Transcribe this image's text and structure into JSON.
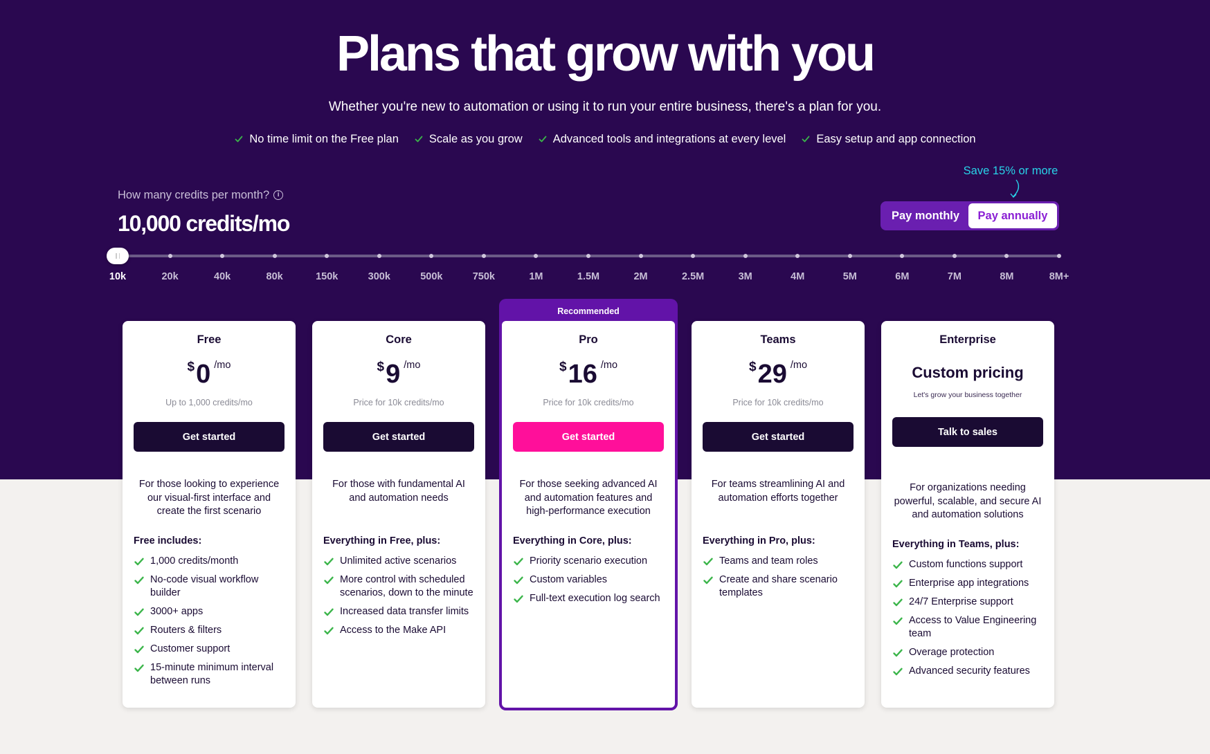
{
  "hero": {
    "title": "Plans that grow with you",
    "subtitle": "Whether you're new to automation or using it to run your entire business, there's a plan for you.",
    "benefits": [
      "No time limit on the Free plan",
      "Scale as you grow",
      "Advanced tools and integrations at every level",
      "Easy setup and app connection"
    ]
  },
  "credits": {
    "question": "How many credits per month?",
    "value": "10,000 credits/mo",
    "slider_ticks": [
      "10k",
      "20k",
      "40k",
      "80k",
      "150k",
      "300k",
      "500k",
      "750k",
      "1M",
      "1.5M",
      "2M",
      "2.5M",
      "3M",
      "4M",
      "5M",
      "6M",
      "7M",
      "8M",
      "8M+"
    ],
    "selected_tick": "10k"
  },
  "billing": {
    "save_note": "Save 15% or more",
    "monthly_label": "Pay monthly",
    "annually_label": "Pay annually",
    "selected": "Pay annually"
  },
  "recommended_label": "Recommended",
  "plans": [
    {
      "name": "Free",
      "currency": "$",
      "amount": "0",
      "per": "/mo",
      "price_note": "Up to 1,000 credits/mo",
      "cta": "Get started",
      "description": "For those looking to experience our visual-first interface and create the first scenario",
      "includes_title": "Free includes:",
      "features": [
        "1,000 credits/month",
        "No-code visual workflow builder",
        "3000+ apps",
        "Routers & filters",
        "Customer support",
        "15-minute minimum interval between runs"
      ]
    },
    {
      "name": "Core",
      "currency": "$",
      "amount": "9",
      "per": "/mo",
      "price_note": "Price for 10k credits/mo",
      "cta": "Get started",
      "description": "For those with fundamental AI and automation needs",
      "includes_title": "Everything in Free, plus:",
      "features": [
        "Unlimited active scenarios",
        "More control with scheduled scenarios, down to the minute",
        "Increased data transfer limits",
        "Access to the Make API"
      ]
    },
    {
      "name": "Pro",
      "currency": "$",
      "amount": "16",
      "per": "/mo",
      "price_note": "Price for 10k credits/mo",
      "cta": "Get started",
      "description": "For those seeking advanced AI and automation features and high-performance execution",
      "includes_title": "Everything in Core, plus:",
      "features": [
        "Priority scenario execution",
        "Custom variables",
        "Full-text execution log search"
      ]
    },
    {
      "name": "Teams",
      "currency": "$",
      "amount": "29",
      "per": "/mo",
      "price_note": "Price for 10k credits/mo",
      "cta": "Get started",
      "description": "For teams streamlining AI and automation efforts together",
      "includes_title": "Everything in Pro, plus:",
      "features": [
        "Teams and team roles",
        "Create and share scenario templates"
      ]
    },
    {
      "name": "Enterprise",
      "custom_price": "Custom pricing",
      "price_note": "Let's grow your business together",
      "cta": "Talk to sales",
      "description": "For organizations needing powerful, scalable, and secure AI and automation solutions",
      "includes_title": "Everything in Teams, plus:",
      "features": [
        "Custom functions support",
        "Enterprise app integrations",
        "24/7 Enterprise support",
        "Access to Value Engineering team",
        "Overage protection",
        "Advanced security features"
      ]
    }
  ],
  "colors": {
    "hero_bg": "#2a0850",
    "page_bg": "#f3f1ef",
    "cta_dark": "#1a0b33",
    "cta_pink": "#ff0f9a",
    "check_green": "#3bb54a",
    "accent_cyan": "#28d3e8",
    "toggle_purple": "#6a1fb0"
  }
}
